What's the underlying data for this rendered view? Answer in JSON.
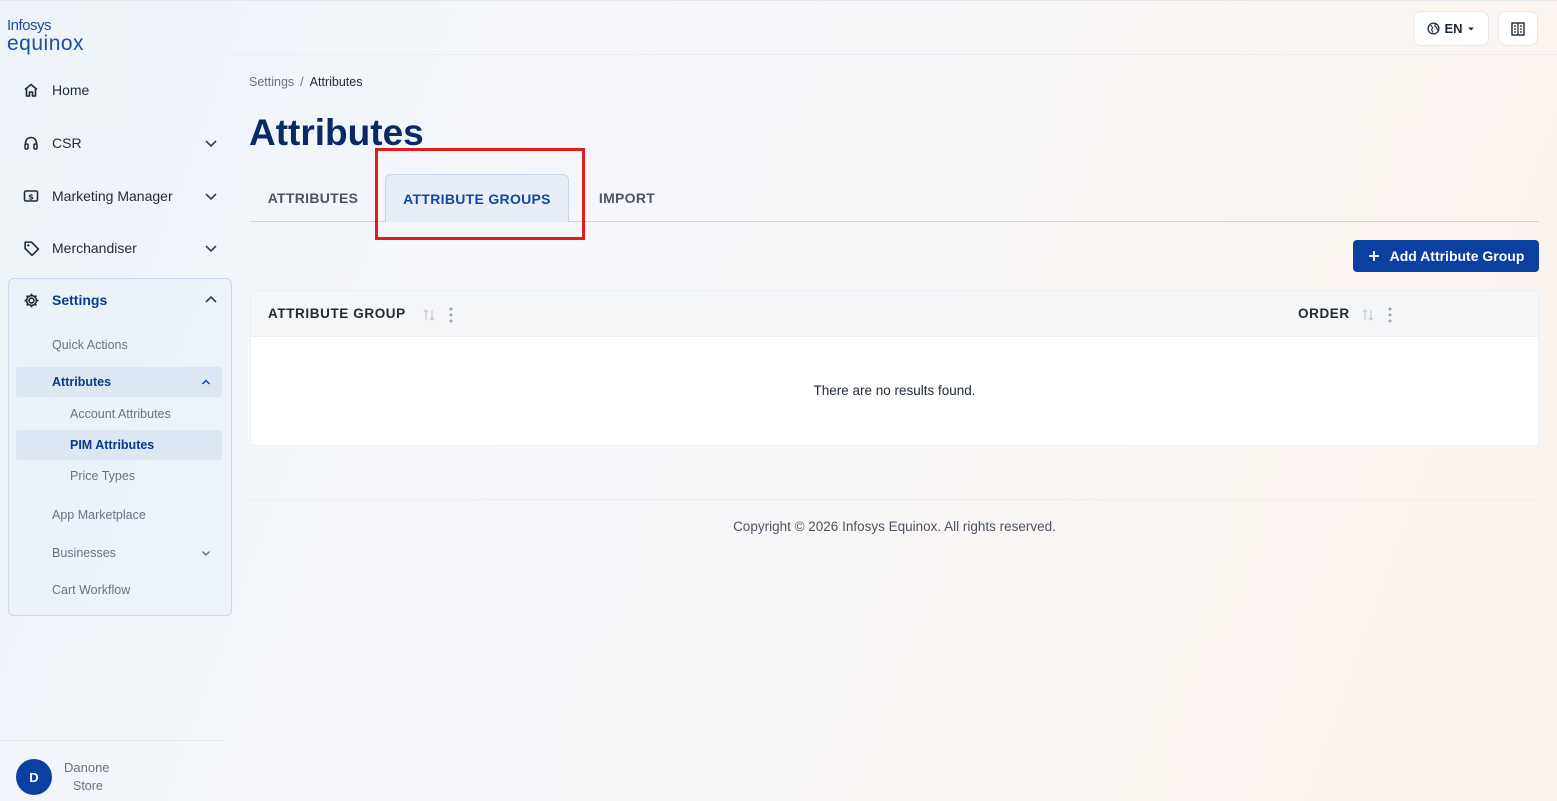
{
  "app": {
    "logo_top": "Infosys",
    "logo_bottom": "equinox"
  },
  "header": {
    "lang_label": "EN"
  },
  "sidebar": {
    "items": [
      {
        "label": "Home",
        "icon": "home-icon"
      },
      {
        "label": "CSR",
        "icon": "headset-icon"
      },
      {
        "label": "Marketing Manager",
        "icon": "dollar-icon"
      },
      {
        "label": "Merchandiser",
        "icon": "tag-icon"
      },
      {
        "label": "Settings",
        "icon": "gear-icon"
      }
    ],
    "settings_sub": [
      {
        "label": "Quick Actions"
      },
      {
        "label": "Attributes"
      },
      {
        "label": "Account Attributes"
      },
      {
        "label": "PIM Attributes"
      },
      {
        "label": "Price Types"
      },
      {
        "label": "App Marketplace"
      },
      {
        "label": "Businesses"
      },
      {
        "label": "Cart Workflow"
      }
    ],
    "user": {
      "initial": "D",
      "name": "Danone",
      "store": "Store"
    }
  },
  "breadcrumb": {
    "parent": "Settings",
    "sep": "/",
    "current": "Attributes"
  },
  "page": {
    "title": "Attributes",
    "tabs": [
      {
        "label": "ATTRIBUTES"
      },
      {
        "label": "ATTRIBUTE GROUPS"
      },
      {
        "label": "IMPORT"
      }
    ],
    "active_tab": "ATTRIBUTE GROUPS",
    "add_button": "Add Attribute Group"
  },
  "table": {
    "columns": [
      {
        "label": "ATTRIBUTE GROUP"
      },
      {
        "label": "ORDER"
      }
    ],
    "empty_message": "There are no results found."
  },
  "footer": {
    "copyright": "Copyright © 2026 Infosys Equinox. All rights reserved."
  },
  "colors": {
    "brand": "#0b3fa0",
    "title": "#0a2a66",
    "highlight": "#e01b1b"
  }
}
